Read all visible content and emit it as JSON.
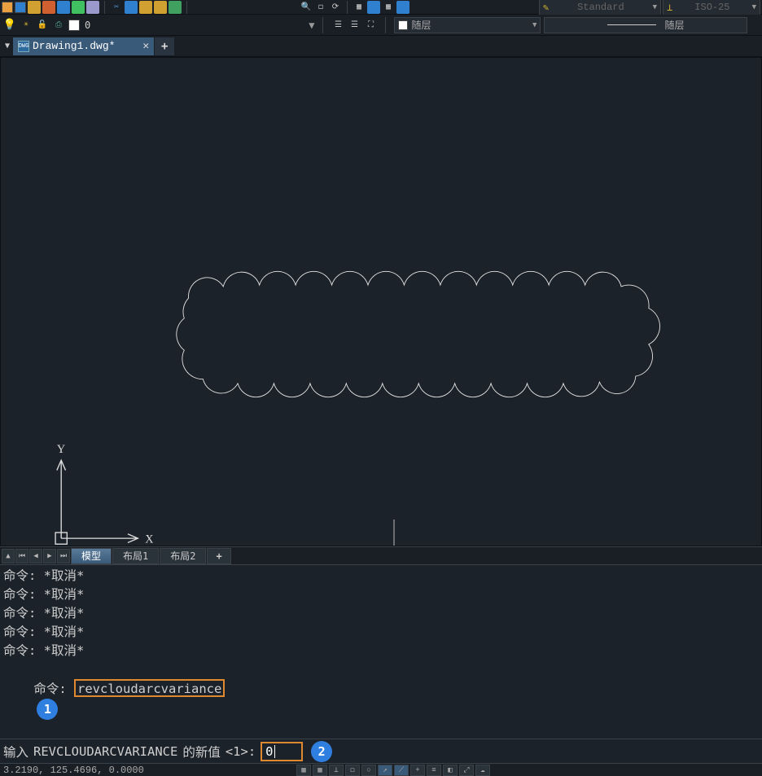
{
  "top_dropdowns": {
    "style": "Standard",
    "dimstyle": "ISO-25"
  },
  "layers": {
    "current": "0",
    "color_label": "随层",
    "linetype_label": "随层"
  },
  "file_tab": {
    "name": "Drawing1.dwg*"
  },
  "layout_tabs": {
    "model": "模型",
    "layout1": "布局1",
    "layout2": "布局2"
  },
  "history": {
    "prefix": "命令:",
    "cancel": " *取消*",
    "typed_cmd": "revcloudarcvariance"
  },
  "annotations": {
    "badge1": "1",
    "badge2": "2"
  },
  "prompt": {
    "prefix": "输入",
    "varname": "REVCLOUDARCVARIANCE",
    "midtext": "的新值",
    "default_br": "<1>:",
    "value": "0"
  },
  "status": {
    "coords": "3.2190, 125.4696, 0.0000"
  }
}
